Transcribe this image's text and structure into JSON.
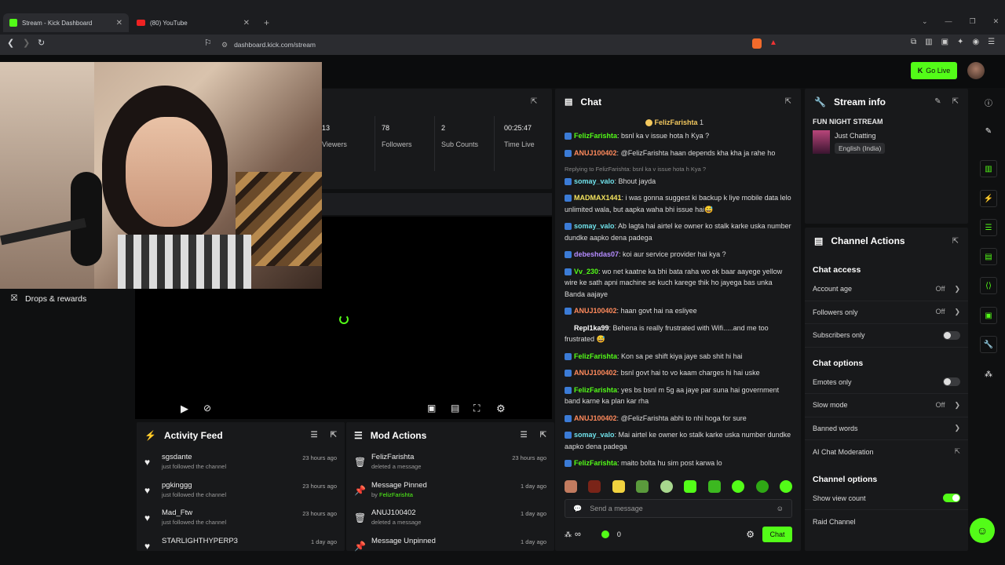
{
  "browser": {
    "tabs": [
      {
        "label": "Stream - Kick Dashboard"
      },
      {
        "label": "(80) YouTube"
      }
    ],
    "url": "dashboard.kick.com/stream"
  },
  "topbar": {
    "go_live": "Go Live"
  },
  "nav": {
    "drops": "Drops & rewards"
  },
  "stats": [
    {
      "value": "13",
      "label": "Viewers"
    },
    {
      "value": "78",
      "label": "Followers"
    },
    {
      "value": "2",
      "label": "Sub Counts"
    },
    {
      "value": "00:25:47",
      "label": "Time Live"
    }
  ],
  "activity_feed": {
    "title": "Activity Feed",
    "items": [
      {
        "name": "sgsdante",
        "sub": "just followed the channel",
        "time": "23 hours ago"
      },
      {
        "name": "pgkinggg",
        "sub": "just followed the channel",
        "time": "23 hours ago"
      },
      {
        "name": "Mad_Ftw",
        "sub": "just followed the channel",
        "time": "23 hours ago"
      },
      {
        "name": "STARLIGHTHYPERP3",
        "sub": "",
        "time": "1 day ago"
      }
    ]
  },
  "mod_actions": {
    "title": "Mod Actions",
    "items": [
      {
        "name": "FelizFarishta",
        "sub": "deleted a message",
        "by": "",
        "time": "23 hours ago"
      },
      {
        "name": "Message Pinned",
        "sub": "by ",
        "by": "FelizFarishta",
        "time": "1 day ago"
      },
      {
        "name": "ANUJ100402",
        "sub": "deleted a message",
        "by": "",
        "time": "1 day ago"
      },
      {
        "name": "Message Unpinned",
        "sub": "",
        "by": "",
        "time": "1 day ago"
      }
    ]
  },
  "chat": {
    "title": "Chat",
    "pinned": "FelizFarishta",
    "pinned_count": "1",
    "messages": [
      {
        "user": "FelizFarishta",
        "color": "#53fc18",
        "text": "bsnl ka v issue hota h Kya ?",
        "reply": ""
      },
      {
        "user": "ANUJ100402",
        "color": "#ff8a5c",
        "text": "@FelizFarishta haan depends kha kha ja rahe ho",
        "reply": ""
      },
      {
        "user": "somay_valo",
        "color": "#6fe0e9",
        "text": "Bhout jayda",
        "reply": "Replying to FelizFarishta: bsnl ka v issue hota h Kya ?"
      },
      {
        "user": "MADMAX1441",
        "color": "#f3e35e",
        "text": "i was gonna suggest ki backup k liye mobile data lelo unlimited wala, but aapka waha bhi issue hai😅",
        "reply": ""
      },
      {
        "user": "somay_valo",
        "color": "#6fe0e9",
        "text": "Ab lagta hai airtel ke owner ko stalk karke uska number dundke aapko dena padega",
        "reply": ""
      },
      {
        "user": "debeshdas07",
        "color": "#b58cff",
        "text": "koi aur service provider hai kya ?",
        "reply": ""
      },
      {
        "user": "Vv_230",
        "color": "#53fc18",
        "text": "wo net kaatne ka bhi bata raha wo ek baar aayege yellow wire ke sath apni machine se kuch karege thik ho jayega bas unka Banda aajaye",
        "reply": ""
      },
      {
        "user": "ANUJ100402",
        "color": "#ff8a5c",
        "text": "haan govt hai na esliyee",
        "reply": ""
      },
      {
        "user": "Repl1ka99",
        "color": "#ffffff",
        "text": "Behena is really frustrated with Wifi.....and me too frustrated 😅",
        "reply": ""
      },
      {
        "user": "FelizFarishta",
        "color": "#53fc18",
        "text": "Kon sa pe shift kiya jaye sab shit hi hai",
        "reply": ""
      },
      {
        "user": "ANUJ100402",
        "color": "#ff8a5c",
        "text": "bsnl govt hai to vo kaam charges hi hai uske",
        "reply": ""
      },
      {
        "user": "FelizFarishta",
        "color": "#53fc18",
        "text": "yes bs bsnl m 5g aa jaye par suna hai government band karne ka plan kar rha",
        "reply": ""
      },
      {
        "user": "ANUJ100402",
        "color": "#ff8a5c",
        "text": "@FelizFarishta abhi to nhi hoga for sure",
        "reply": ""
      },
      {
        "user": "somay_valo",
        "color": "#6fe0e9",
        "text": "Mai airtel ke owner ko stalk karke uska number dundke aapko dena padega",
        "reply": ""
      },
      {
        "user": "FelizFarishta",
        "color": "#53fc18",
        "text": "maito bolta hu sim post karwa lo",
        "reply": ""
      }
    ],
    "placeholder": "Send a message",
    "infinity": "∞",
    "count": "0",
    "send": "Chat"
  },
  "stream_info": {
    "title": "Stream info",
    "stream_title": "FUN NIGHT STREAM",
    "category": "Just Chatting",
    "language": "English (India)"
  },
  "channel_actions": {
    "title": "Channel Actions",
    "chat_access": "Chat access",
    "account_age": {
      "label": "Account age",
      "value": "Off"
    },
    "followers_only": {
      "label": "Followers only",
      "value": "Off"
    },
    "subscribers_only": {
      "label": "Subscribers only"
    },
    "chat_options": "Chat options",
    "emotes_only": {
      "label": "Emotes only"
    },
    "slow_mode": {
      "label": "Slow mode",
      "value": "Off"
    },
    "banned_words": {
      "label": "Banned words"
    },
    "ai_moderation": {
      "label": "AI Chat Moderation"
    },
    "channel_options": "Channel options",
    "show_view_count": {
      "label": "Show view count",
      "on": true
    },
    "raid": {
      "label": "Raid Channel"
    }
  },
  "colors": {
    "accent": "#53fc18",
    "panel": "#18191b"
  }
}
